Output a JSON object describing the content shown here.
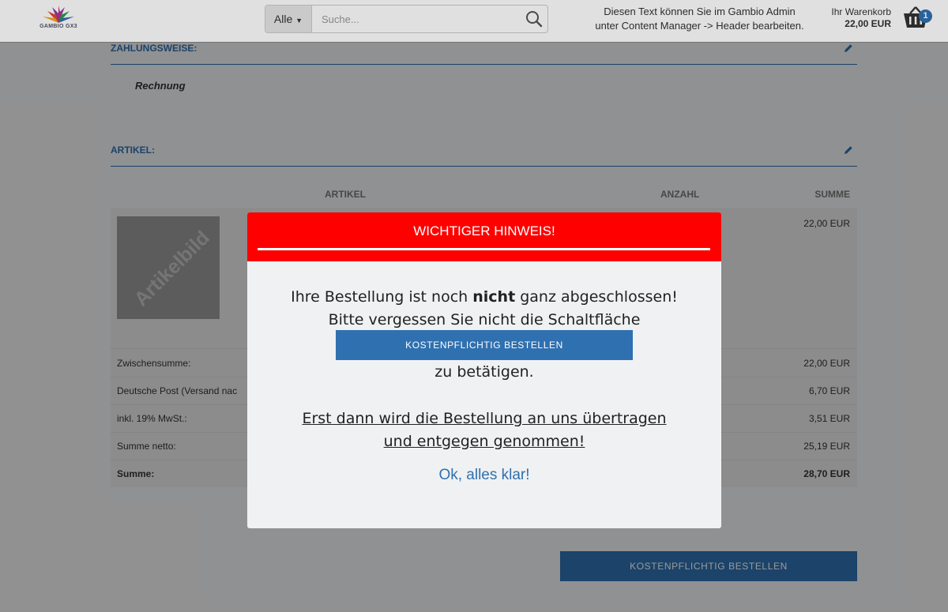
{
  "header": {
    "logo_text": "GAMBIO GX3",
    "search_category": "Alle",
    "search_placeholder": "Suche...",
    "note_line1": "Diesen Text können Sie im Gambio Admin",
    "note_line2": "unter Content Manager -> Header bearbeiten.",
    "cart_label": "Ihr Warenkorb",
    "cart_total": "22,00 EUR",
    "cart_count": "1"
  },
  "payment": {
    "title": "ZAHLUNGSWEISE:",
    "value": "Rechnung"
  },
  "articles": {
    "title": "ARTIKEL:",
    "columns": {
      "article": "ARTIKEL",
      "quantity": "ANZAHL",
      "sum": "SUMME"
    },
    "product": {
      "image_label": "Artikelbild",
      "price": "22,00 EUR"
    },
    "totals": [
      {
        "label": "Zwischensumme:",
        "value": "22,00 EUR"
      },
      {
        "label": "Deutsche Post (Versand nac",
        "value": "6,70 EUR"
      },
      {
        "label": "inkl. 19% MwSt.:",
        "value": "3,51 EUR"
      },
      {
        "label": "Summe netto:",
        "value": "25,19 EUR"
      },
      {
        "label": "Summe:",
        "value": "28,70 EUR"
      }
    ]
  },
  "order_button": "KOSTENPFLICHTIG BESTELLEN",
  "modal": {
    "title": "WICHTIGER HINWEIS!",
    "line1_before": "Ihre Bestellung ist noch ",
    "line1_bold": "nicht",
    "line1_after": " ganz abgeschlossen!",
    "line2": "Bitte vergessen Sie nicht die Schaltfläche",
    "button": "KOSTENPFLICHTIG BESTELLEN",
    "line3": "zu betätigen.",
    "underline1": "Erst dann wird die Bestellung an uns übertragen",
    "underline2": "und entgegen genommen!",
    "ok": "Ok, alles klar!"
  },
  "colors": {
    "accent": "#2f70b0",
    "modal_header": "#ff0000"
  }
}
